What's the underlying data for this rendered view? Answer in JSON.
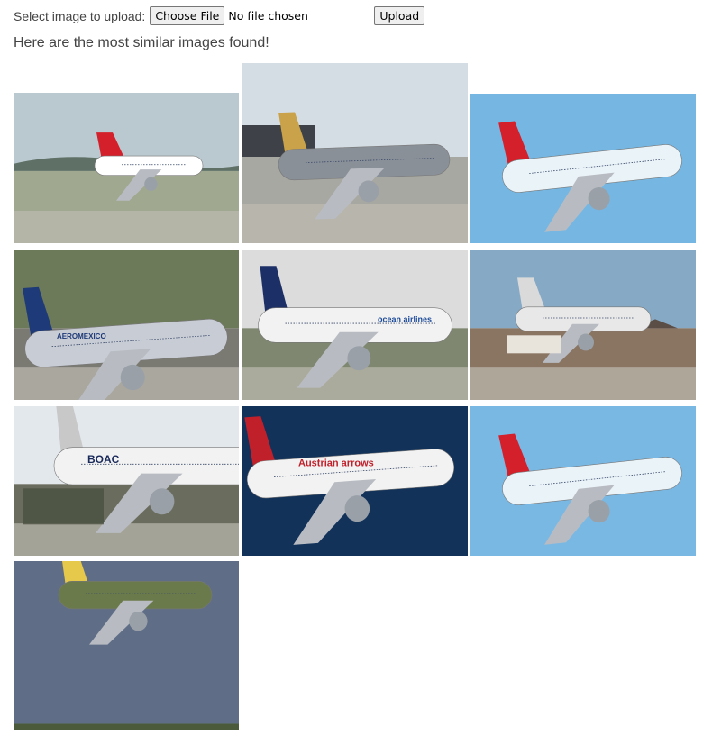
{
  "upload": {
    "label": "Select image to upload:",
    "choose_button": "Choose File",
    "file_status": "No file chosen",
    "submit_button": "Upload"
  },
  "results": {
    "heading": "Here are the most similar images found!",
    "images": [
      {
        "name": "result-image-1",
        "scene": "airliner-field",
        "sky": "#b9c9cf",
        "ground": "#a0a890",
        "livery": "#ffffff",
        "tail": "#d4202a"
      },
      {
        "name": "result-image-2",
        "scene": "fighter-jet",
        "sky": "#d5dde4",
        "ground": "#a8a8a2",
        "livery": "#8a9098",
        "tail": "#c9a24a"
      },
      {
        "name": "result-image-3",
        "scene": "jet-sky",
        "sky": "#75b7e2",
        "livery": "#eaf3f8",
        "tail": "#d4202a"
      },
      {
        "name": "result-image-4",
        "scene": "airliner-ramp",
        "sky": "#6d7a5a",
        "ground": "#7b7a72",
        "livery": "#c8ccd4",
        "tail": "#1e3a78",
        "airline": "AEROMEXICO"
      },
      {
        "name": "result-image-5",
        "scene": "airliner-runway",
        "sky": "#dcdcdc",
        "ground": "#7f8770",
        "livery": "#f2f2f2",
        "tail": "#1c2f66",
        "airline": "ocean airlines"
      },
      {
        "name": "result-image-6",
        "scene": "turboprop-ramp",
        "sky": "#86a9c6",
        "ground": "#8a7563",
        "livery": "#e8e8e8",
        "tail": "#dadada"
      },
      {
        "name": "result-image-7",
        "scene": "vintage-jumbo",
        "sky": "#e3e8ec",
        "ground": "#6a6d5e",
        "livery": "#f2f2f2",
        "tail": "#c8c8c8",
        "airline": "BOAC"
      },
      {
        "name": "result-image-8",
        "scene": "jet-dark-sky",
        "sky": "#12325a",
        "livery": "#f2f2f2",
        "tail": "#c0202a",
        "airline": "Austrian arrows"
      },
      {
        "name": "result-image-9",
        "scene": "jet-sky",
        "sky": "#7ab8e4",
        "livery": "#eaf3f8",
        "tail": "#d4202a"
      },
      {
        "name": "result-image-10",
        "scene": "warbird",
        "sky": "#5f6e86",
        "ground": "#4a5a3a",
        "livery": "#6b7a4a",
        "tail": "#e6c94a"
      }
    ]
  }
}
